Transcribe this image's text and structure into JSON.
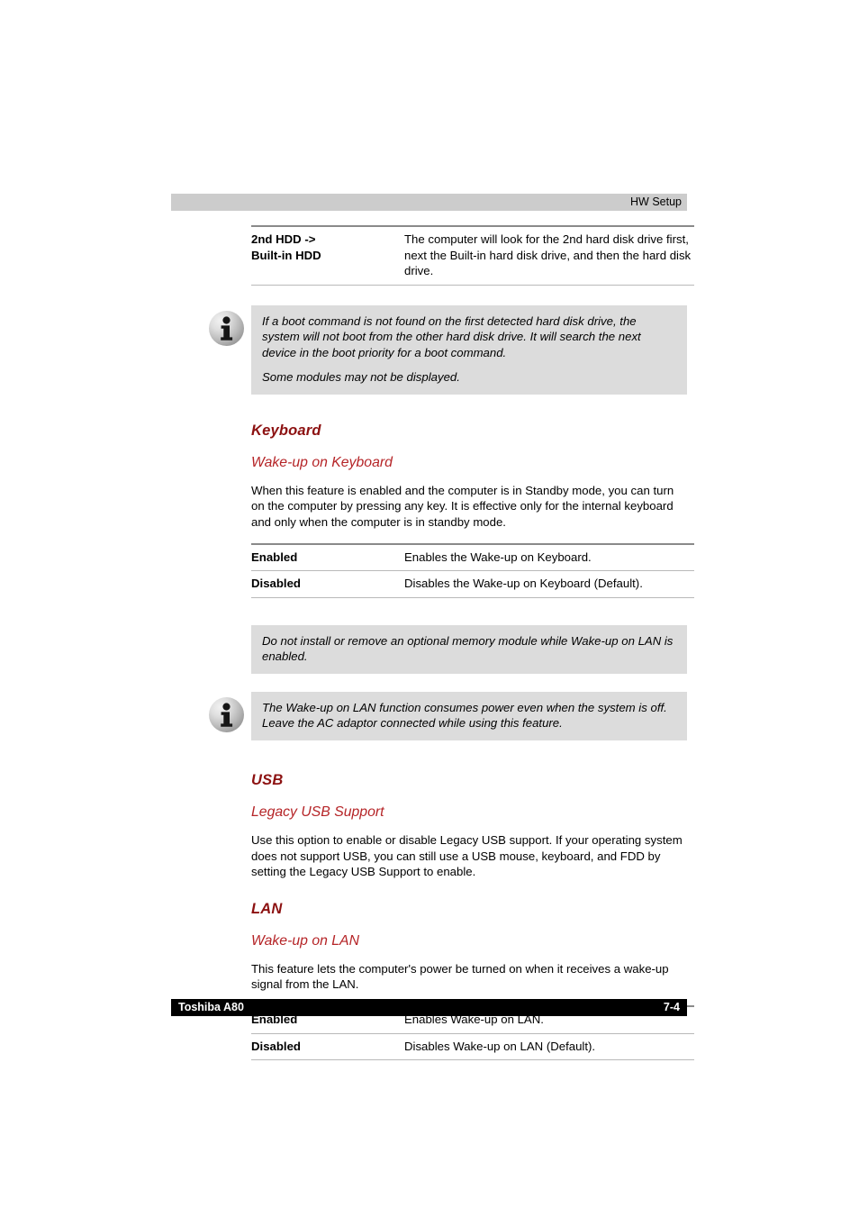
{
  "header": {
    "title": "HW Setup"
  },
  "footer": {
    "left": "Toshiba A80",
    "page": "7-4"
  },
  "colors": {
    "section_heading": "#8c1111",
    "sub_heading": "#b52427",
    "header_bar": "#cccccc",
    "note_background": "#dcdcdc",
    "footer_bar": "#000000",
    "rule_top": "#8a8a8a",
    "rule_bottom": "#b9b9b9"
  },
  "boot_table": {
    "rows": [
      {
        "term_line1": "2nd HDD ->",
        "term_line2": "Built-in HDD",
        "desc": "The computer will look for the 2nd hard disk drive first, next the Built-in hard disk drive, and then the hard disk drive."
      }
    ]
  },
  "note_boot": {
    "icon": "info-icon",
    "paragraphs": [
      "If a boot command is not found on the first detected hard disk drive, the system will not boot from the other hard disk drive. It will search the next device in the boot priority for a boot command.",
      "Some modules may not be displayed."
    ]
  },
  "keyboard": {
    "heading": "Keyboard",
    "subheading": "Wake-up on Keyboard",
    "body": "When this feature is enabled and the computer is in Standby mode, you can turn on the computer by pressing any key. It is effective only for the internal keyboard and only when the computer is in standby mode.",
    "table": {
      "rows": [
        {
          "term": "Enabled",
          "desc": "Enables the Wake-up on Keyboard."
        },
        {
          "term": "Disabled",
          "desc": "Disables the Wake-up on Keyboard (Default)."
        }
      ]
    }
  },
  "note_memory_module": {
    "icon": "none",
    "paragraphs": [
      "Do not install or remove an optional memory module while Wake-up on LAN is enabled."
    ]
  },
  "note_wakeup_lan_power": {
    "icon": "info-icon",
    "paragraphs": [
      "The Wake-up on LAN function consumes power even when the system is off. Leave the AC adaptor connected while using this feature."
    ]
  },
  "usb": {
    "heading": "USB",
    "subheading": "Legacy USB Support",
    "body": "Use this option to enable or disable Legacy USB support. If your operating system does not support USB, you can still use a USB mouse, keyboard, and FDD by setting the Legacy USB Support to enable."
  },
  "lan": {
    "heading": "LAN",
    "subheading": "Wake-up on LAN",
    "body": "This feature lets the computer's power be turned on when it receives a wake-up signal from the LAN.",
    "table": {
      "rows": [
        {
          "term": "Enabled",
          "desc": "Enables Wake-up on LAN."
        },
        {
          "term": "Disabled",
          "desc": "Disables Wake-up on LAN (Default)."
        }
      ]
    }
  }
}
